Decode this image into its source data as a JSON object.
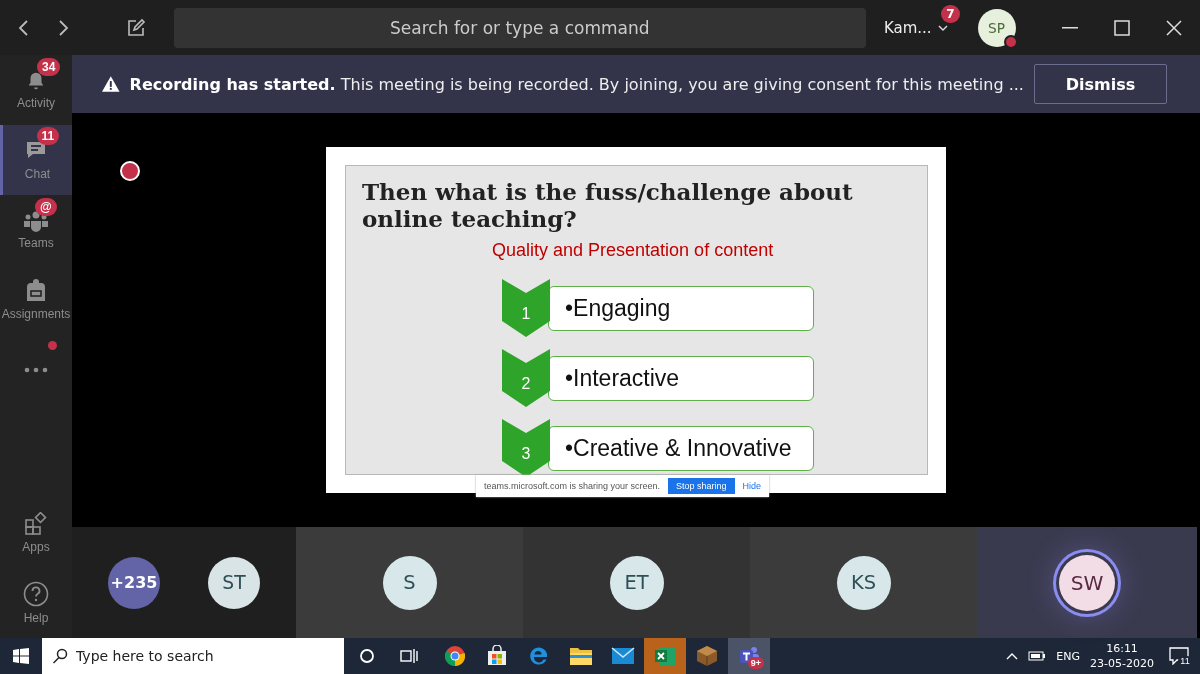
{
  "top_bar": {
    "search": {
      "placeholder": "Search for or type a command"
    },
    "user": "Kam...",
    "notification_badge": "7",
    "avatar": "SP"
  },
  "rail": {
    "items": [
      {
        "kind": "bell",
        "label": "Activity",
        "badge": "34",
        "selected": false
      },
      {
        "kind": "chat",
        "label": "Chat",
        "badge": "11",
        "selected": true
      },
      {
        "kind": "teams",
        "label": "Teams",
        "badge": "@",
        "selected": false
      },
      {
        "kind": "bag",
        "label": "Assignments",
        "selected": false
      },
      {
        "kind": "more",
        "dot": true,
        "selected": false
      }
    ],
    "bottom": [
      {
        "kind": "apps",
        "label": "Apps"
      },
      {
        "kind": "help",
        "label": "Help"
      }
    ]
  },
  "banner": {
    "title": "Recording has started.",
    "message": "This meeting is being recorded. By joining, you are giving consent for this meeting ...",
    "button": "Dismiss"
  },
  "slide": {
    "title": "Then what is the fuss/challenge about online teaching?",
    "subtitle": "Quality and Presentation of content",
    "steps": [
      {
        "number": "1",
        "text": "•Engaging"
      },
      {
        "number": "2",
        "text": "•Interactive"
      },
      {
        "number": "3",
        "text": "•Creative & Innovative"
      }
    ],
    "sharing_bar": {
      "message": "teams.microsoft.com is sharing your screen.",
      "stop": "Stop sharing",
      "hide": "Hide"
    }
  },
  "participants": {
    "overflow": "+235",
    "people": [
      {
        "initials": "ST",
        "speaking": false
      },
      {
        "initials": "S",
        "speaking": false
      },
      {
        "initials": "ET",
        "speaking": false
      },
      {
        "initials": "KS",
        "speaking": false
      },
      {
        "initials": "SW",
        "speaking": true
      }
    ]
  },
  "taskbar": {
    "search": {
      "placeholder": "Type here to search"
    },
    "apps": [
      {
        "kind": "chrome",
        "active": false
      },
      {
        "kind": "store",
        "active": false
      },
      {
        "kind": "edge",
        "active": false
      },
      {
        "kind": "folder",
        "active": false
      },
      {
        "kind": "mail",
        "active": false
      },
      {
        "kind": "excel",
        "active": true
      },
      {
        "kind": "cube",
        "active": false
      },
      {
        "kind": "teams",
        "active": true,
        "badge": "9+"
      }
    ],
    "language": "ENG",
    "time": "16:11",
    "date": "23-05-2020",
    "notifications": "11"
  }
}
